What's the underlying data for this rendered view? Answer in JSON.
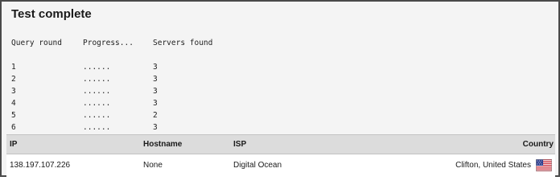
{
  "title": "Test complete",
  "log": {
    "headers": [
      "Query round",
      "Progress...",
      "Servers found"
    ],
    "rows": [
      [
        "1",
        "......",
        "3"
      ],
      [
        "2",
        "......",
        "3"
      ],
      [
        "3",
        "......",
        "3"
      ],
      [
        "4",
        "......",
        "3"
      ],
      [
        "5",
        "......",
        "2"
      ],
      [
        "6",
        "......",
        "3"
      ]
    ]
  },
  "table": {
    "headers": {
      "ip": "IP",
      "hostname": "Hostname",
      "isp": "ISP",
      "country": "Country"
    },
    "rows": [
      {
        "ip": "138.197.107.226",
        "hostname": "None",
        "isp": "Digital Ocean",
        "country": "Clifton, United States",
        "flag": "us-flag-icon"
      }
    ]
  }
}
